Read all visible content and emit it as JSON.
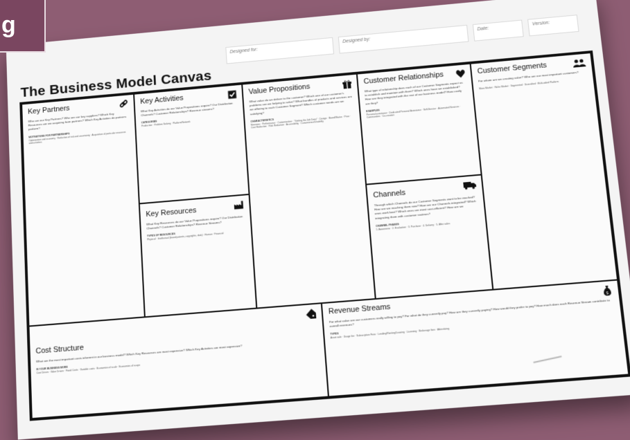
{
  "corner_badge": "g",
  "header": {
    "designed_for": "Designed for:",
    "designed_by": "Designed by:",
    "date": "Date:",
    "version": "Version:"
  },
  "title": "The Business Model Canvas",
  "blocks": {
    "key_partners": {
      "label": "Key Partners",
      "icon": "link-icon",
      "questions": "Who are our Key Partners? Who are our key suppliers? Which Key Resources are we acquiring from partners? Which Key Activities do partners perform?",
      "sub": "MOTIVATIONS FOR PARTNERSHIPS",
      "list": "Optimization and economy · Reduction of risk and uncertainty · Acquisition of particular resources and activities"
    },
    "key_activities": {
      "label": "Key Activities",
      "icon": "checkbox-icon",
      "questions": "What Key Activities do our Value Propositions require? Our Distribution Channels? Customer Relationships? Revenue streams?",
      "sub": "CATEGORIES",
      "list": "Production · Problem Solving · Platform/Network"
    },
    "key_resources": {
      "label": "Key Resources",
      "icon": "factory-icon",
      "questions": "What Key Resources do our Value Propositions require? Our Distribution Channels? Customer Relationships? Revenue Streams?",
      "sub": "TYPES OF RESOURCES",
      "list": "Physical · Intellectual (brand patents, copyrights, data) · Human · Financial"
    },
    "value_propositions": {
      "label": "Value Propositions",
      "icon": "gift-icon",
      "questions": "What value do we deliver to the customer? Which one of our customer's problems are we helping to solve? What bundles of products and services are we offering to each Customer Segment? Which customer needs are we satisfying?",
      "sub": "CHARACTERISTICS",
      "list": "Newness · Performance · Customization · \"Getting the Job Done\" · Design · Brand/Status · Price · Cost Reduction · Risk Reduction · Accessibility · Convenience/Usability"
    },
    "customer_relationships": {
      "label": "Customer Relationships",
      "icon": "heart-icon",
      "questions": "What type of relationship does each of our Customer Segments expect us to establish and maintain with them? Which ones have we established? How are they integrated with the rest of our business model? How costly are they?",
      "sub": "EXAMPLES",
      "list": "Personal assistance · Dedicated Personal Assistance · Self-Service · Automated Services · Communities · Co-creation"
    },
    "channels": {
      "label": "Channels",
      "icon": "truck-icon",
      "questions": "Through which Channels do our Customer Segments want to be reached? How are we reaching them now? How are our Channels integrated? Which ones work best? Which ones are most cost-efficient? How are we integrating them with customer routines?",
      "sub": "CHANNEL PHASES",
      "list": "1. Awareness · 2. Evaluation · 3. Purchase · 4. Delivery · 5. After sales"
    },
    "customer_segments": {
      "label": "Customer Segments",
      "icon": "people-icon",
      "questions": "For whom are we creating value? Who are our most important customers?",
      "sub": "",
      "list": "Mass Market · Niche Market · Segmented · Diversified · Multi-sided Platform"
    },
    "cost_structure": {
      "label": "Cost Structure",
      "icon": "tag-icon",
      "questions": "What are the most important costs inherent in our business model? Which Key Resources are most expensive? Which Key Activities are most expensive?",
      "sub": "IS YOUR BUSINESS MORE",
      "list": "Cost Driven · Value Driven · Fixed Costs · Variable costs · Economies of scale · Economies of scope"
    },
    "revenue_streams": {
      "label": "Revenue Streams",
      "icon": "moneybag-icon",
      "questions": "For what value are our customers really willing to pay? For what do they currently pay? How are they currently paying? How would they prefer to pay? How much does each Revenue Stream contribute to overall revenues?",
      "sub": "TYPES",
      "list": "Asset sale · Usage fee · Subscription Fees · Lending/Renting/Leasing · Licensing · Brokerage fees · Advertising"
    }
  }
}
